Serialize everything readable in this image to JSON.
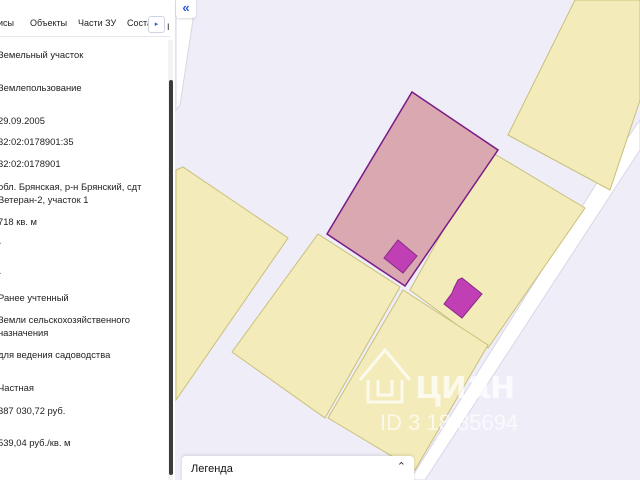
{
  "tabs": {
    "items": [
      "исы",
      "Объекты",
      "Части ЗУ",
      "Соста"
    ],
    "edge": "I"
  },
  "fields": {
    "category": "Земельный участок",
    "type": "Землепользование",
    "date": "29.09.2005",
    "cadastral_number": "32:02:0178901:35",
    "quarter": "32:02:0178901",
    "address": "обл. Брянская, р-н Брянский, сдт Ветеран-2, участок 1",
    "area": "718 кв. м",
    "dash1": "-",
    "dash2": "-",
    "status": "Ранее учтенный",
    "land_category": "Земли сельскохозяйственного назначения",
    "usage": "для ведения садоводства",
    "ownership": "Частная",
    "cadastral_value": "387 030,72 руб.",
    "specific_value": "539,04 руб./кв. м"
  },
  "legend": {
    "label": "Легенда"
  },
  "watermark": {
    "brand": "циан",
    "id": "ID 3 18 85694"
  },
  "colors": {
    "map_bg": "#efedf8",
    "parcel_yellow": "#f3ebb9",
    "parcel_yellow_stroke": "#c9c07a",
    "selected_fill": "#d9a8b0",
    "selected_stroke": "#7a1a86",
    "building": "#c03fb4",
    "accent": "#2b5bd7"
  }
}
